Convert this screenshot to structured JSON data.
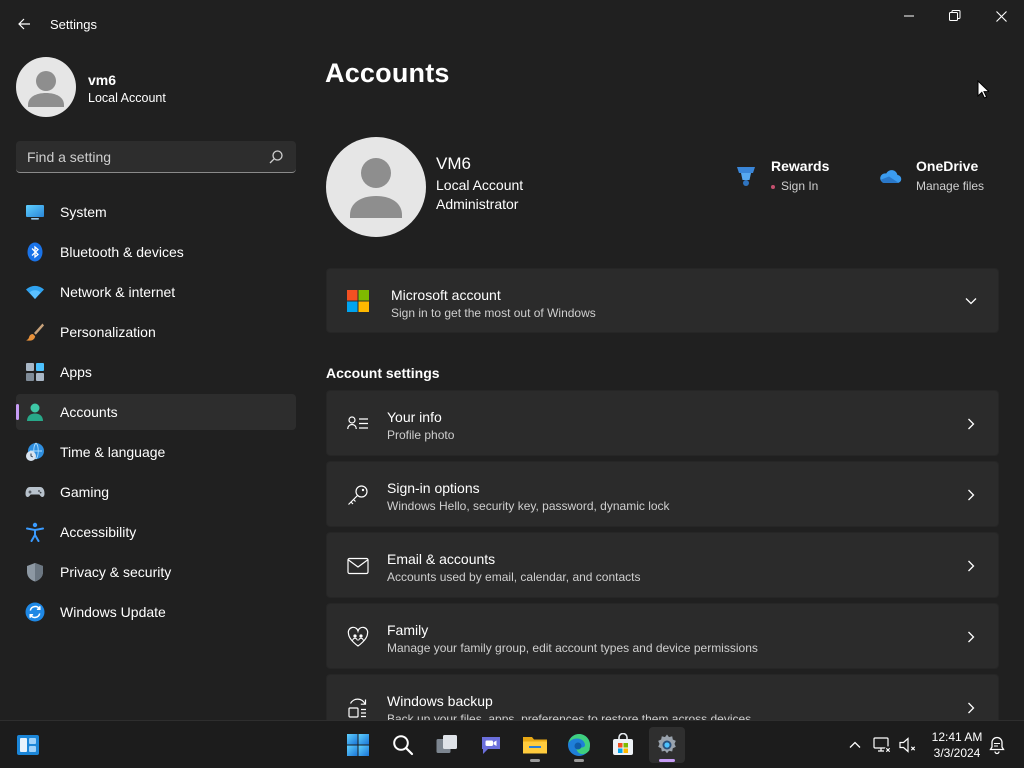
{
  "window": {
    "title": "Settings",
    "controls": {
      "minimize": "minimize-icon",
      "restore": "restore-icon",
      "close": "close-icon"
    }
  },
  "sidebar": {
    "profile": {
      "name": "vm6",
      "type": "Local Account"
    },
    "search": {
      "placeholder": "Find a setting",
      "value": ""
    },
    "items": [
      {
        "label": "System",
        "icon": "system-icon"
      },
      {
        "label": "Bluetooth & devices",
        "icon": "bluetooth-icon"
      },
      {
        "label": "Network & internet",
        "icon": "wifi-icon"
      },
      {
        "label": "Personalization",
        "icon": "brush-icon"
      },
      {
        "label": "Apps",
        "icon": "apps-icon"
      },
      {
        "label": "Accounts",
        "icon": "accounts-icon",
        "active": true
      },
      {
        "label": "Time & language",
        "icon": "time-language-icon"
      },
      {
        "label": "Gaming",
        "icon": "gamepad-icon"
      },
      {
        "label": "Accessibility",
        "icon": "accessibility-icon"
      },
      {
        "label": "Privacy & security",
        "icon": "shield-icon"
      },
      {
        "label": "Windows Update",
        "icon": "windows-update-icon"
      }
    ]
  },
  "main": {
    "title": "Accounts",
    "account": {
      "name": "VM6",
      "type": "Local Account",
      "role": "Administrator"
    },
    "quick_links": [
      {
        "title": "Rewards",
        "subtitle": "Sign In",
        "icon": "rewards-icon"
      },
      {
        "title": "OneDrive",
        "subtitle": "Manage files",
        "icon": "onedrive-icon"
      }
    ],
    "microsoft_account": {
      "title": "Microsoft account",
      "subtitle": "Sign in to get the most out of Windows",
      "icon": "microsoft-logo-icon"
    },
    "section_label": "Account settings",
    "settings_cards": [
      {
        "title": "Your info",
        "subtitle": "Profile photo",
        "icon": "your-info-icon"
      },
      {
        "title": "Sign-in options",
        "subtitle": "Windows Hello, security key, password, dynamic lock",
        "icon": "key-icon"
      },
      {
        "title": "Email & accounts",
        "subtitle": "Accounts used by email, calendar, and contacts",
        "icon": "mail-icon"
      },
      {
        "title": "Family",
        "subtitle": "Manage your family group, edit account types and device permissions",
        "icon": "family-heart-icon"
      },
      {
        "title": "Windows backup",
        "subtitle": "Back up your files, apps, preferences to restore them across devices",
        "icon": "backup-icon"
      }
    ]
  },
  "taskbar": {
    "apps": [
      "widgets-icon",
      "start-icon",
      "search-icon",
      "task-view-icon",
      "teams-chat-icon",
      "file-explorer-icon",
      "edge-icon",
      "store-icon",
      "settings-gear-icon"
    ],
    "clock": {
      "time": "12:41 AM",
      "date": "3/3/2024"
    }
  },
  "colors": {
    "accent": "#c69cf5",
    "background": "#202020",
    "card": "#2b2b2b"
  }
}
